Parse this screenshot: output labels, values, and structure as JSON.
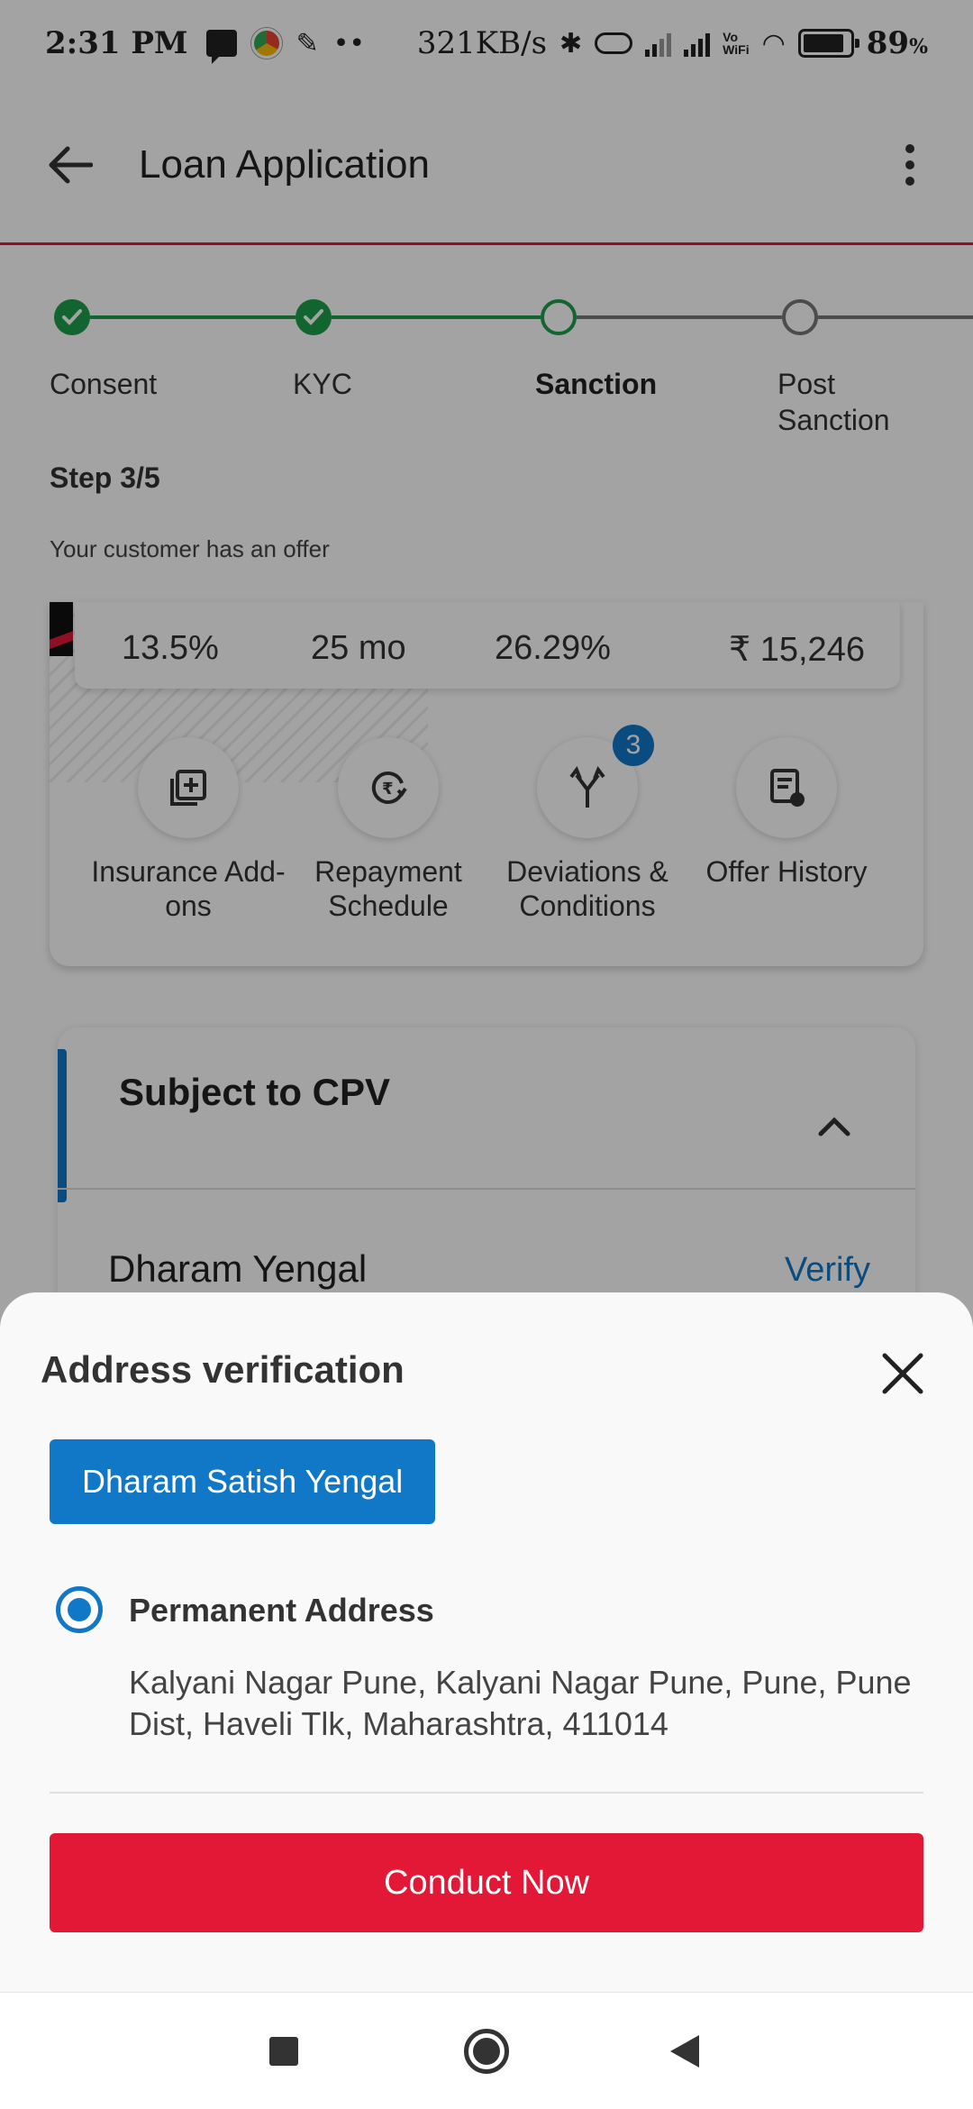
{
  "status_bar": {
    "time": "2:31 PM",
    "net_speed": "321KB/s",
    "dots": "••",
    "volte_label": "Vo\nWiFi",
    "battery": "89",
    "battery_unit": "%"
  },
  "app_bar": {
    "title": "Loan Application"
  },
  "stepper": {
    "steps": [
      {
        "label": "Consent",
        "state": "done"
      },
      {
        "label": "KYC",
        "state": "done"
      },
      {
        "label": "Sanction",
        "state": "current"
      },
      {
        "label": "Post\nSanction",
        "state": "todo"
      }
    ],
    "step_count": "Step 3/5",
    "note": "Your customer has an offer"
  },
  "offer": {
    "values": [
      "13.5%",
      "25 mo",
      "26.29%",
      "₹ 15,246"
    ],
    "actions": [
      {
        "label": "Insurance Add-\nons",
        "icon": "add-box-icon"
      },
      {
        "label": "Repayment\nSchedule",
        "icon": "rupee-refresh-icon"
      },
      {
        "label": "Deviations &\nConditions",
        "icon": "split-arrows-icon",
        "badge": "3"
      },
      {
        "label": "Offer History",
        "icon": "document-clock-icon"
      }
    ]
  },
  "cpv": {
    "title": "Subject to CPV",
    "name": "Dharam Yengal",
    "verify_label": "Verify"
  },
  "sheet": {
    "title": "Address verification",
    "applicant_chip": "Dharam Satish Yengal",
    "address_type": "Permanent Address",
    "address": "Kalyani Nagar Pune, Kalyani Nagar Pune, Pune, Pune Dist, Haveli Tlk, Maharashtra, 411014",
    "cta_label": "Conduct Now"
  },
  "colors": {
    "brand_red": "#e31837",
    "accent_blue": "#1178c8",
    "success_green": "#1e9e4a"
  }
}
